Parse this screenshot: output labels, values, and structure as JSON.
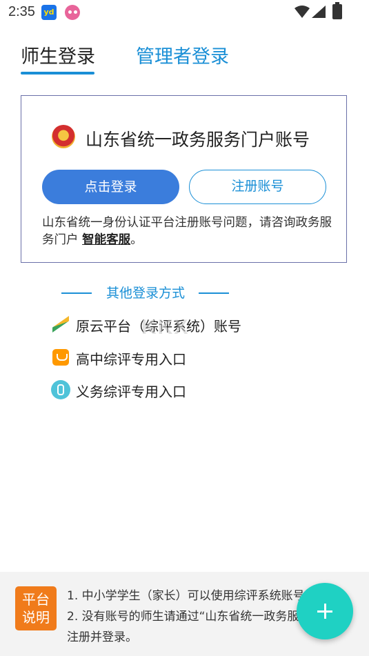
{
  "status_bar": {
    "time": "2:35",
    "app_icon_1": "yunjiao-app-icon",
    "app_icon_2": "pink-app-icon",
    "icons": [
      "wifi-icon",
      "signal-icon",
      "battery-icon"
    ]
  },
  "tabs": [
    {
      "label": "师生登录",
      "active": true
    },
    {
      "label": "管理者登录",
      "active": false
    }
  ],
  "login_card": {
    "title": "山东省统一政务服务门户账号",
    "emblem_icon": "national-emblem-icon",
    "login_button": "点击登录",
    "register_button": "注册账号",
    "note_text": "山东省统一身份认证平台注册账号问题，请咨询政务服务门户 ",
    "note_link": "智能客服",
    "note_end": "。"
  },
  "other_methods": {
    "title": "其他登录方式",
    "options": [
      {
        "label": "原云平台（综评系统）账号",
        "icon": "yuanyun-platform-icon"
      },
      {
        "label": "高中综评专用入口",
        "icon": "high-school-icon"
      },
      {
        "label": "义务综评专用入口",
        "icon": "compulsory-education-icon"
      }
    ]
  },
  "watermark": "KKX",
  "bottom_bar": {
    "badge_line1": "平台",
    "badge_line2": "说明",
    "notice_lines": [
      "1. 中小学学生（家长）可以使用综评系统账号",
      "2. 没有账号的师生请通过“山东省统一政务服务",
      "注册并登录。"
    ]
  },
  "colors": {
    "accent_blue": "#1a8fd6",
    "login_button": "#3b7ddc",
    "badge_orange": "#f07b1b",
    "fab_teal": "#1fd1c3"
  }
}
